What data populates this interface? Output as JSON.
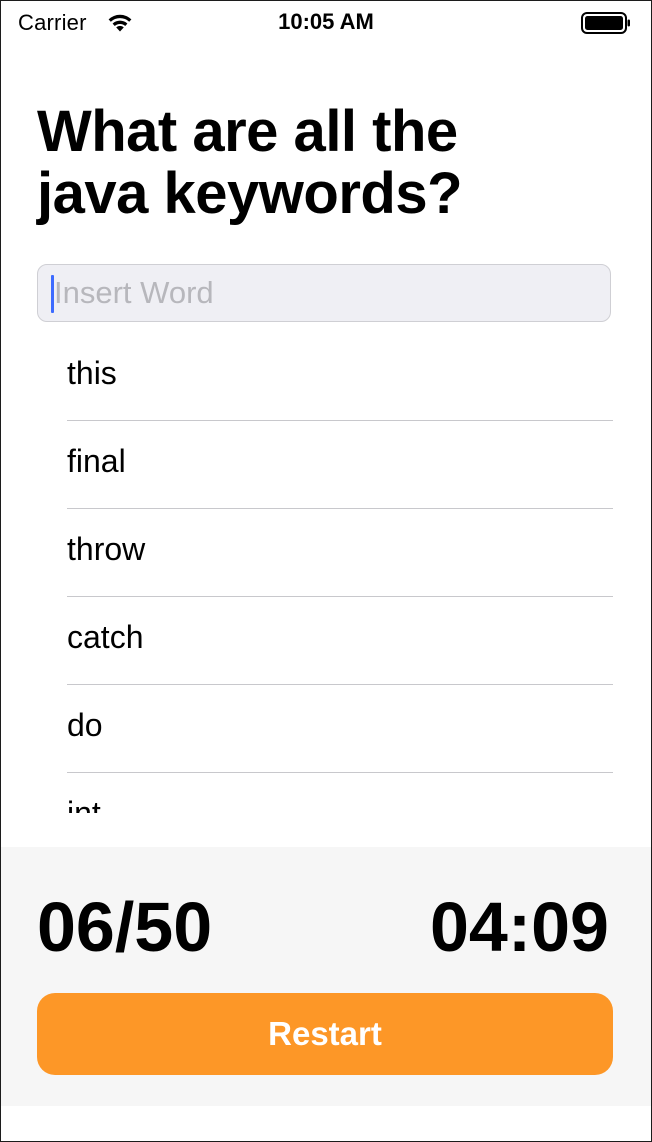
{
  "status_bar": {
    "carrier": "Carrier",
    "time": "10:05 AM",
    "wifi_icon": "wifi-icon",
    "battery_icon": "battery-icon"
  },
  "question": {
    "line1": "What are all the",
    "line2": "java keywords?"
  },
  "input": {
    "value": "",
    "placeholder": "Insert Word"
  },
  "words": [
    "this",
    "final",
    "throw",
    "catch",
    "do",
    "int"
  ],
  "footer": {
    "score": "06/50",
    "timer": "04:09",
    "restart_label": "Restart"
  },
  "colors": {
    "accent": "#fd9727",
    "caret": "#3d6bff",
    "footer_bg": "#f6f6f6",
    "input_bg": "#efeff4"
  }
}
